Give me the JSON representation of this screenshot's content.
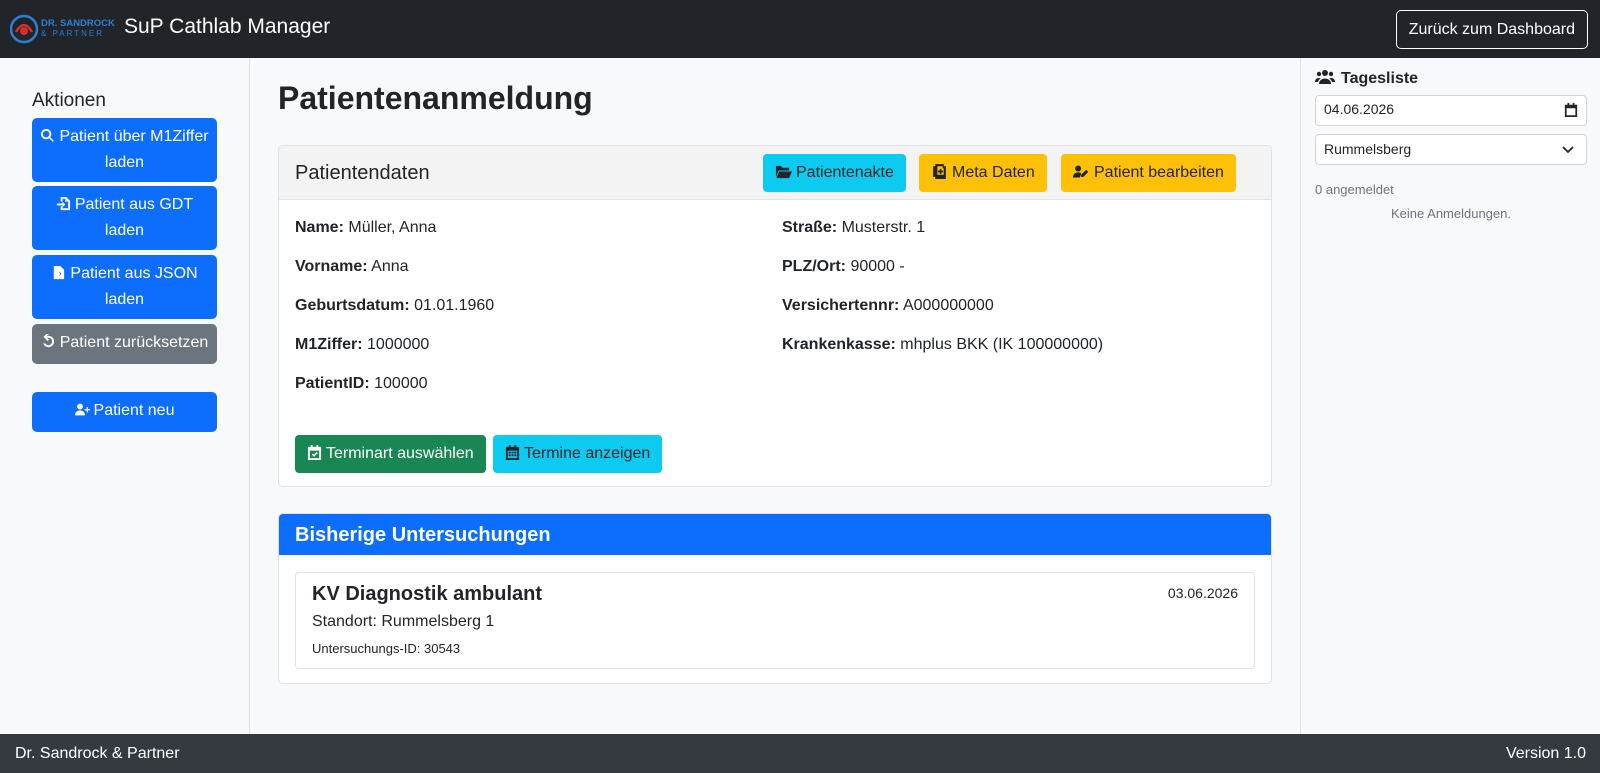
{
  "navbar": {
    "logo_text_line1": "DR. SANDROCK",
    "logo_text_line2": "& PARTNER",
    "title": "SuP Cathlab Manager",
    "back_button": "Zurück zum Dashboard"
  },
  "sidebar": {
    "heading": "Aktionen",
    "buttons": [
      {
        "label": "Patient über M1Ziffer laden",
        "icon": "search-icon"
      },
      {
        "label": "Patient aus GDT laden",
        "icon": "file-import-icon"
      },
      {
        "label": "Patient aus JSON laden",
        "icon": "file-code-icon"
      },
      {
        "label": "Patient zurücksetzen",
        "icon": "undo-icon"
      },
      {
        "label": "Patient neu",
        "icon": "user-plus-icon"
      }
    ]
  },
  "main": {
    "page_title": "Patientenanmeldung",
    "patient_card": {
      "title": "Patientendaten",
      "header_buttons": {
        "akte": "Patientenakte",
        "meta": "Meta Daten",
        "edit": "Patient bearbeiten"
      },
      "fields_left": [
        {
          "label": "Name:",
          "value": "Müller, Anna"
        },
        {
          "label": "Vorname:",
          "value": "Anna"
        },
        {
          "label": "Geburtsdatum:",
          "value": "01.01.1960"
        },
        {
          "label": "M1Ziffer:",
          "value": "1000000"
        },
        {
          "label": "PatientID:",
          "value": "100000"
        }
      ],
      "fields_right": [
        {
          "label": "Straße:",
          "value": "Musterstr. 1"
        },
        {
          "label": "PLZ/Ort:",
          "value": "90000 -"
        },
        {
          "label": "Versichertennr:",
          "value": "A000000000"
        },
        {
          "label": "Krankenkasse:",
          "value": "mhplus BKK (IK 100000000)"
        }
      ],
      "actions": {
        "terminart": "Terminart auswählen",
        "termine": "Termine anzeigen"
      }
    },
    "exams_card": {
      "title": "Bisherige Untersuchungen",
      "items": [
        {
          "title": "KV Diagnostik ambulant",
          "date": "03.06.2026",
          "location": "Standort: Rummelsberg 1",
          "id": "Untersuchungs-ID: 30543"
        }
      ]
    }
  },
  "tagesliste": {
    "title": "Tagesliste",
    "date": "04.06.2026",
    "location": "Rummelsberg",
    "count": "0 angemeldet",
    "empty": "Keine Anmeldungen."
  },
  "footer": {
    "left": "Dr. Sandrock & Partner",
    "right": "Version 1.0"
  },
  "colors": {
    "navbar": "#212529",
    "primary": "#0d6efd",
    "secondary": "#6c757d",
    "info": "#0dcaf0",
    "warning": "#ffc107",
    "success": "#198754",
    "footer": "#343a40"
  }
}
